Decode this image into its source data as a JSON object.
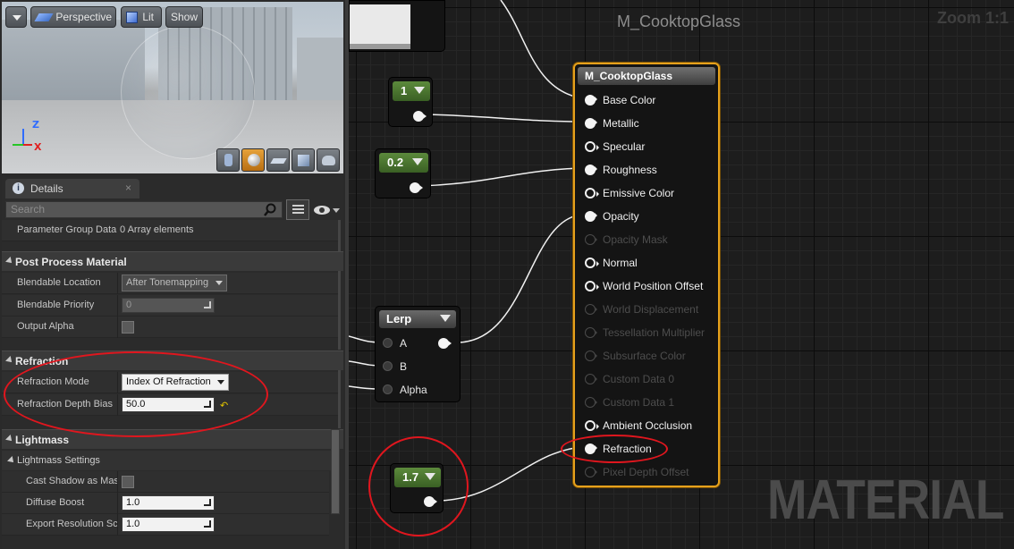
{
  "viewport": {
    "mode_label": "Perspective",
    "lighting_label": "Lit",
    "show_label": "Show",
    "axis_z": "Z",
    "axis_x": "X"
  },
  "details": {
    "tab_label": "Details",
    "tab_close": "×",
    "search_placeholder": "Search",
    "rows": {
      "param_group": {
        "label": "Parameter Group Data",
        "value": "0 Array elements"
      },
      "post_process_category": "Post Process Material",
      "blendable_location": {
        "label": "Blendable Location",
        "value": "After Tonemapping"
      },
      "blendable_priority": {
        "label": "Blendable Priority",
        "value": "0"
      },
      "output_alpha": {
        "label": "Output Alpha"
      },
      "refraction_category": "Refraction",
      "refraction_mode": {
        "label": "Refraction Mode",
        "value": "Index Of Refraction"
      },
      "refraction_depth_bias": {
        "label": "Refraction Depth Bias",
        "value": "50.0"
      },
      "lightmass_category": "Lightmass",
      "lightmass_settings": "Lightmass Settings",
      "cast_shadow": {
        "label": "Cast Shadow as Masked"
      },
      "diffuse_boost": {
        "label": "Diffuse Boost",
        "value": "1.0"
      },
      "export_resolution": {
        "label": "Export Resolution Scale",
        "value": "1.0"
      }
    }
  },
  "graph": {
    "title": "M_CooktopGlass",
    "zoom": "Zoom 1:1",
    "watermark": "MATERIAL",
    "constants": [
      {
        "value": "1"
      },
      {
        "value": "0.2"
      },
      {
        "value": "1.7"
      }
    ],
    "lerp": {
      "title": "Lerp",
      "inputs": [
        "A",
        "B",
        "Alpha"
      ]
    },
    "material_node": {
      "title": "M_CooktopGlass",
      "pins": [
        {
          "label": "Base Color",
          "state": "connected"
        },
        {
          "label": "Metallic",
          "state": "connected"
        },
        {
          "label": "Specular",
          "state": "open"
        },
        {
          "label": "Roughness",
          "state": "connected"
        },
        {
          "label": "Emissive Color",
          "state": "open"
        },
        {
          "label": "Opacity",
          "state": "connected"
        },
        {
          "label": "Opacity Mask",
          "state": "disabled"
        },
        {
          "label": "Normal",
          "state": "open"
        },
        {
          "label": "World Position Offset",
          "state": "open"
        },
        {
          "label": "World Displacement",
          "state": "disabled"
        },
        {
          "label": "Tessellation Multiplier",
          "state": "disabled"
        },
        {
          "label": "Subsurface Color",
          "state": "disabled"
        },
        {
          "label": "Custom Data 0",
          "state": "disabled"
        },
        {
          "label": "Custom Data 1",
          "state": "disabled"
        },
        {
          "label": "Ambient Occlusion",
          "state": "open"
        },
        {
          "label": "Refraction",
          "state": "connected"
        },
        {
          "label": "Pixel Depth Offset",
          "state": "disabled"
        }
      ]
    }
  },
  "colors": {
    "accent_orange": "#e6a11c",
    "highlight_red": "#e0161e",
    "constant_green": "#5c8a3c"
  }
}
